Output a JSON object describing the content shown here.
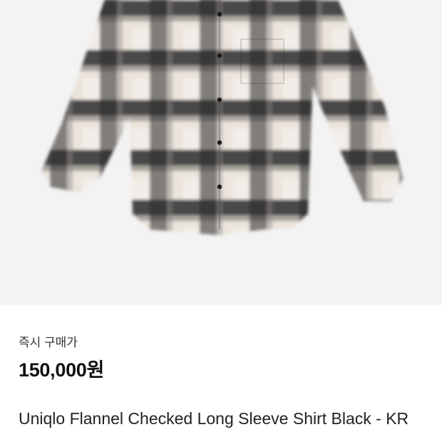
{
  "product": {
    "image_alt": "plaid-flannel-shirt",
    "colors": {
      "dark": "#2b2b2b",
      "mid": "#7d7b78",
      "light": "#ece6df",
      "background": "#f3f3f3"
    },
    "price_label": "즉시 구매가",
    "price": "150,000원",
    "title": "Uniqlo Flannel Checked Long Sleeve Shirt Black - KR"
  }
}
